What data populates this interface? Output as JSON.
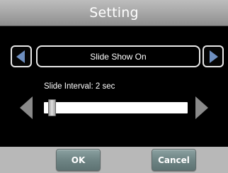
{
  "title": "Setting",
  "option_selector": {
    "value": "Slide Show On",
    "prev_icon": "triangle-left-icon",
    "next_icon": "triangle-right-icon",
    "arrow_color": "#6e8fc0"
  },
  "slider": {
    "label": "Slide Interval: 2 sec",
    "position_fraction": 0.02,
    "decrease_icon": "triangle-left-icon",
    "increase_icon": "triangle-right-icon"
  },
  "buttons": {
    "ok_label": "OK",
    "cancel_label": "Cancel"
  },
  "colors": {
    "background": "#000000",
    "title_bar": "#a9a9a9",
    "bottom_bar": "#b8b8b8",
    "button": "#6f8585"
  }
}
